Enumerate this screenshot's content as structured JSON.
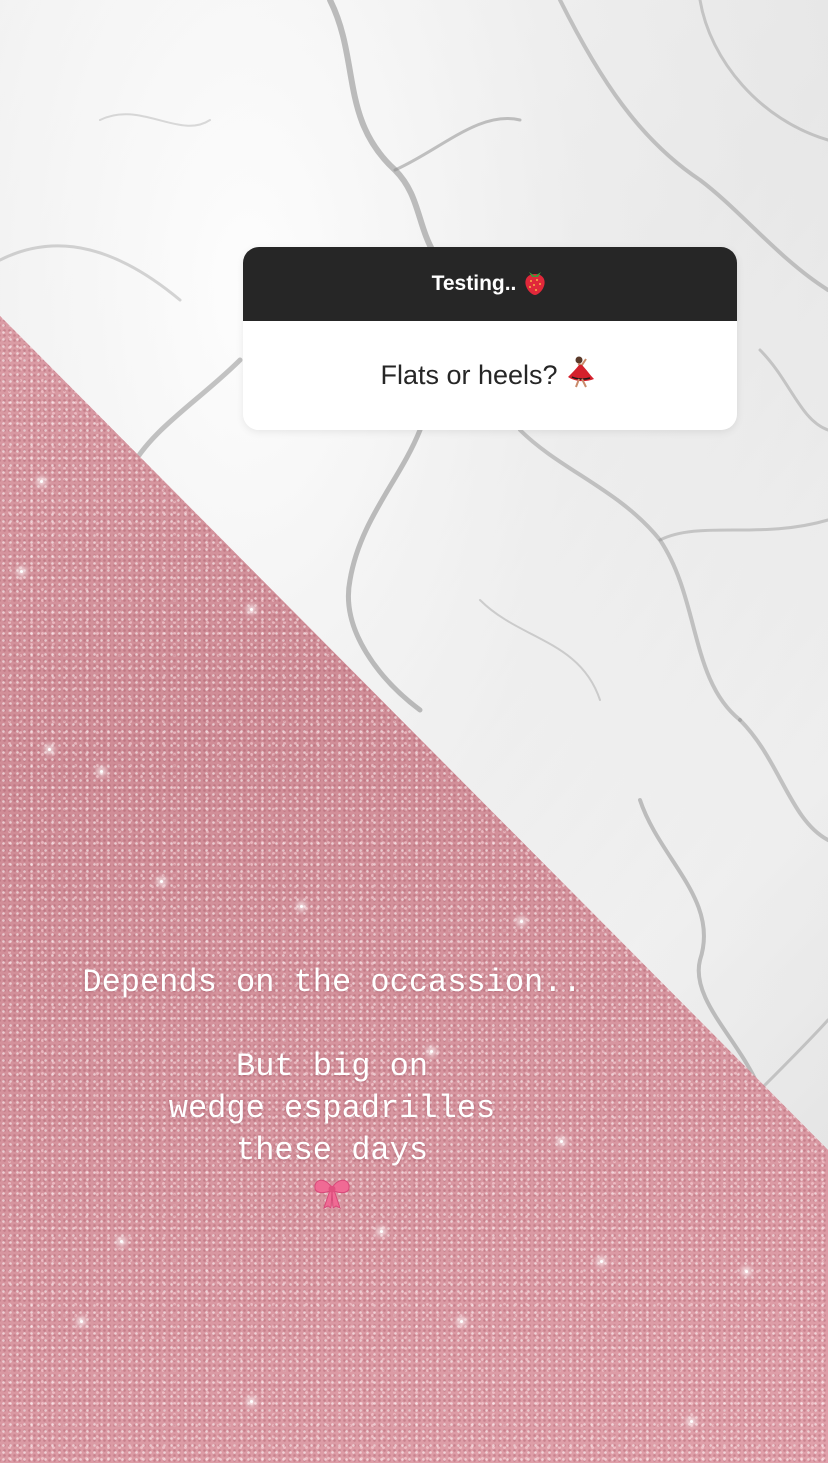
{
  "question_sticker": {
    "header_text": "Testing..",
    "header_emoji": "strawberry-icon",
    "question_text": "Flats or heels?",
    "question_emoji": "dancer-icon"
  },
  "answer": {
    "line1": "Depends on the occassion..",
    "line2": "But big on",
    "line3": "wedge espadrilles",
    "line4": "these days",
    "emoji": "ribbon-bow-icon"
  },
  "colors": {
    "header_bg": "#262626",
    "card_bg": "#ffffff",
    "glitter_pink": "#d99aa2",
    "answer_text": "#ffffff"
  }
}
